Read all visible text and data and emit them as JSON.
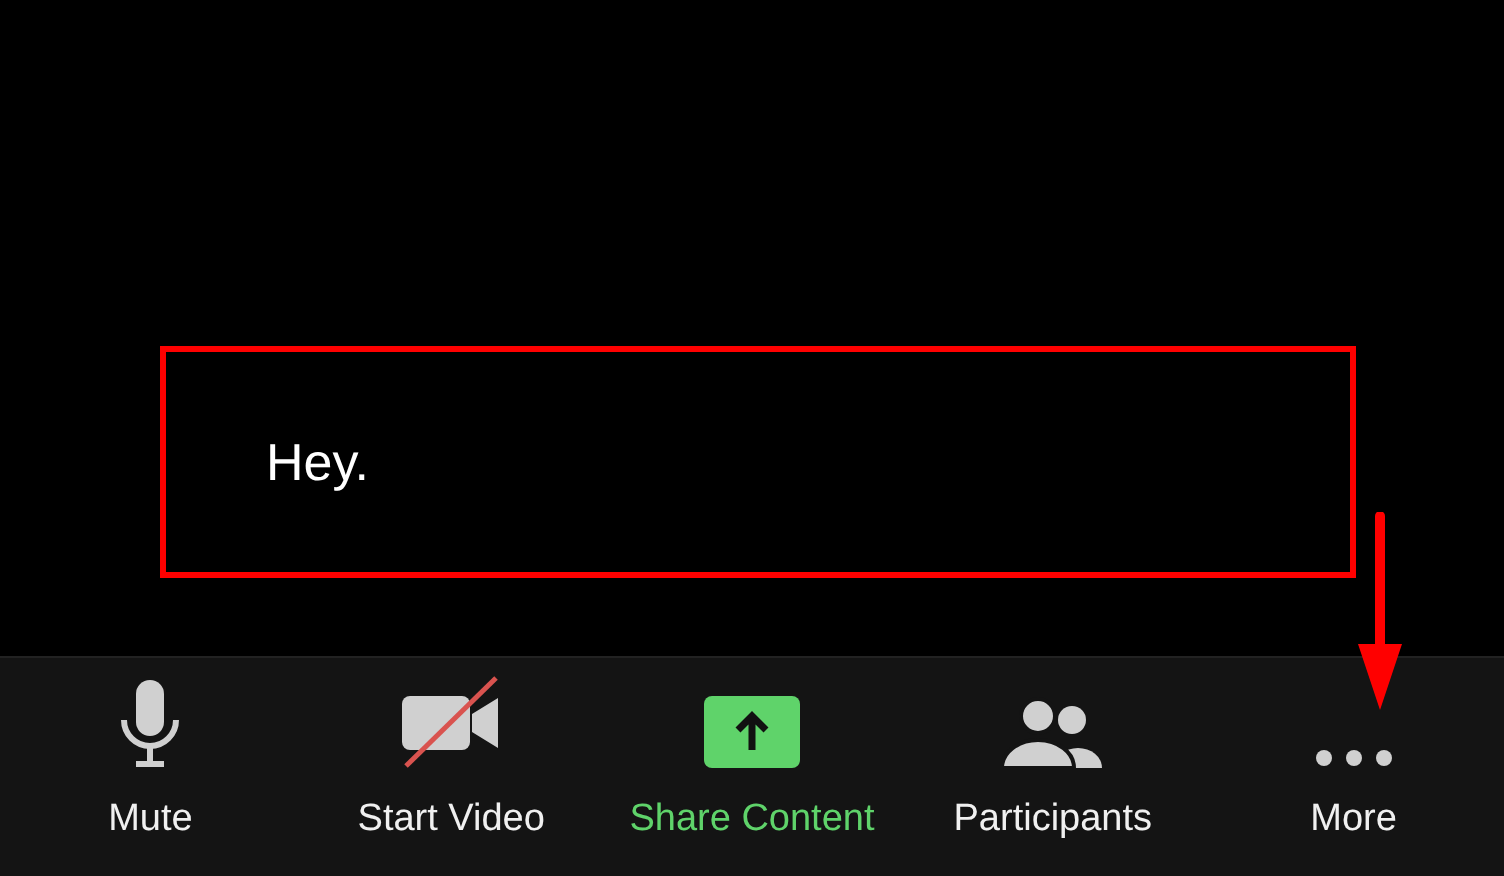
{
  "caption": {
    "text": "Hey."
  },
  "toolbar": [
    {
      "kind": "mic",
      "label": "Mute",
      "active": false
    },
    {
      "kind": "video",
      "label": "Start Video",
      "active": false
    },
    {
      "kind": "share",
      "label": "Share Content",
      "active": true
    },
    {
      "kind": "participants",
      "label": "Participants",
      "active": false
    },
    {
      "kind": "more",
      "label": "More",
      "active": false
    }
  ]
}
